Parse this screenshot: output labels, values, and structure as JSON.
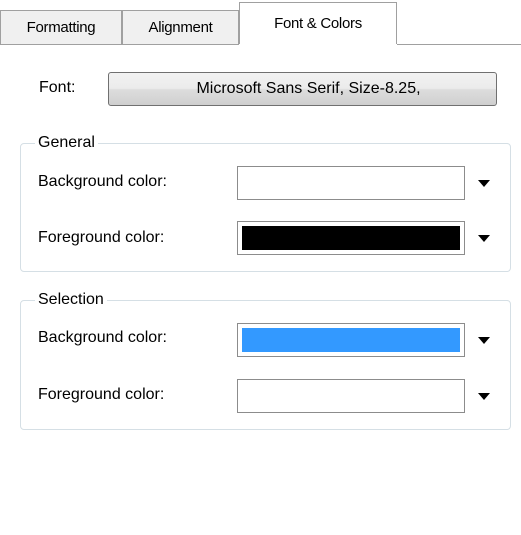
{
  "tabs": [
    {
      "label": "Formatting",
      "active": false
    },
    {
      "label": "Alignment",
      "active": false
    },
    {
      "label": "Font & Colors",
      "active": true
    }
  ],
  "font": {
    "label": "Font:",
    "button_label": "Microsoft Sans Serif, Size-8.25,"
  },
  "general": {
    "title": "General",
    "background": {
      "label": "Background color:",
      "color": "#ffffff"
    },
    "foreground": {
      "label": "Foreground color:",
      "color": "#000000"
    }
  },
  "selection": {
    "title": "Selection",
    "background": {
      "label": "Background color:",
      "color": "#3399ff"
    },
    "foreground": {
      "label": "Foreground color:",
      "color": "#ffffff"
    }
  },
  "icons": {
    "dropdown": "chevron-down-icon"
  }
}
